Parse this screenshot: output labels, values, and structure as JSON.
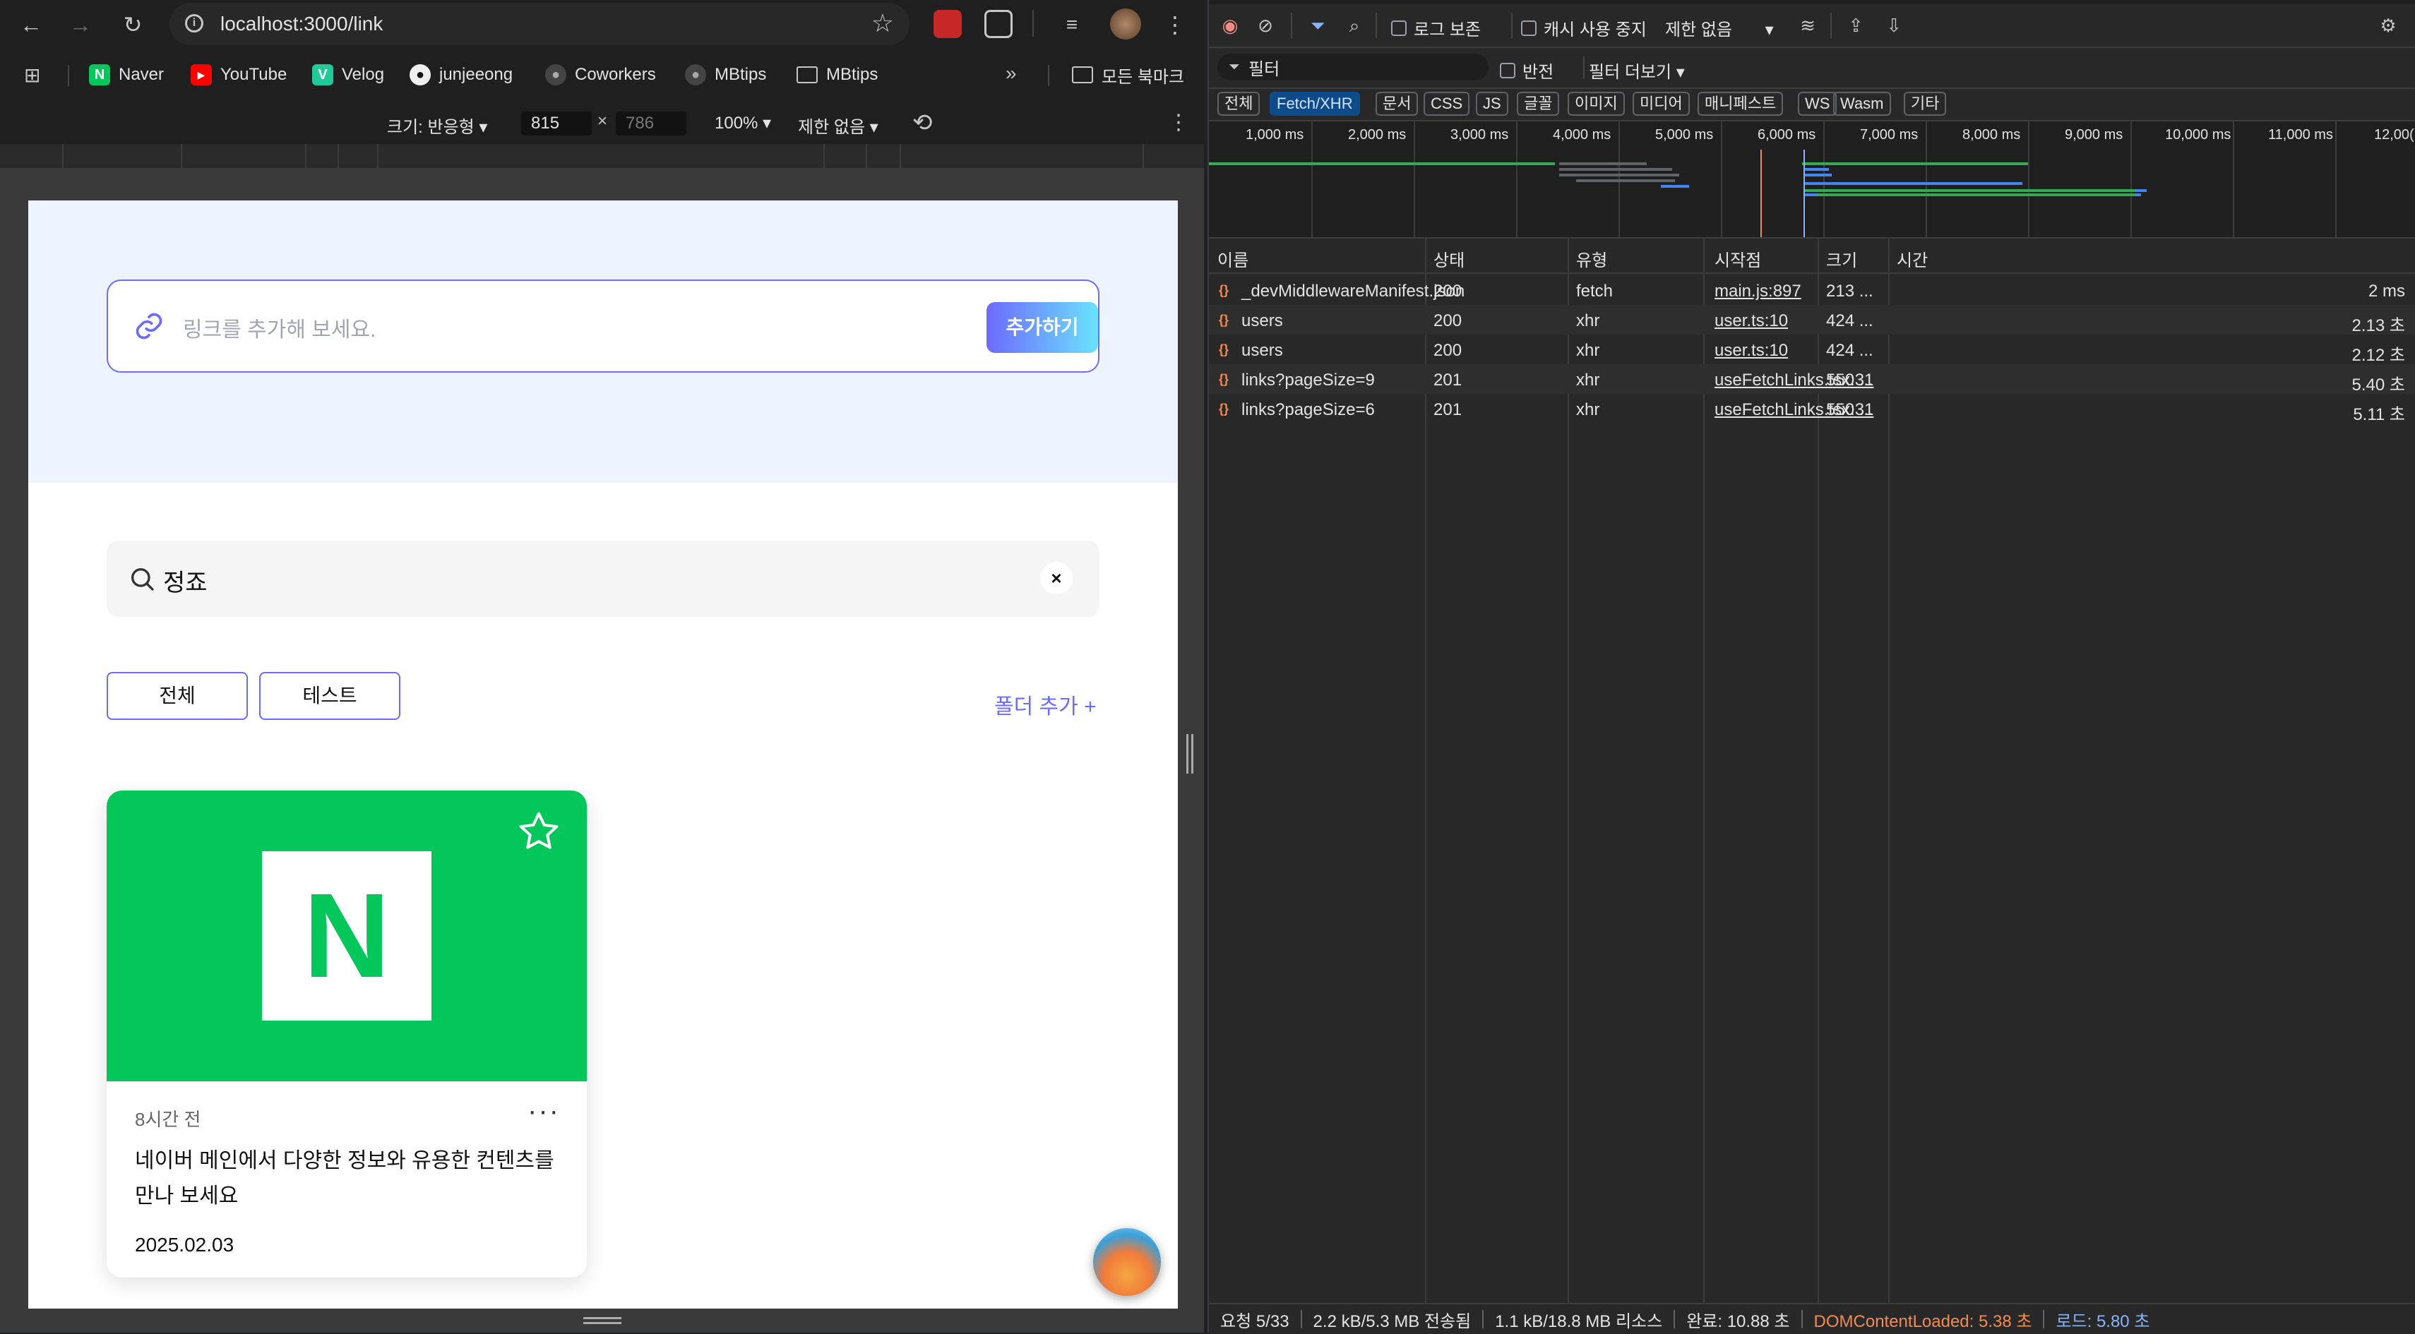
{
  "browser": {
    "url": "localhost:3000/link",
    "bookmarks": [
      {
        "label": "Naver",
        "icon": "naver-icon",
        "color": "#03c75a"
      },
      {
        "label": "YouTube",
        "icon": "youtube-icon",
        "color": "#ff0000"
      },
      {
        "label": "Velog",
        "icon": "velog-icon",
        "color": "#20c997"
      },
      {
        "label": "junjeeong",
        "icon": "github-icon"
      },
      {
        "label": "Coworkers",
        "icon": "github-icon"
      },
      {
        "label": "MBtips",
        "icon": "github-icon"
      },
      {
        "label": "MBtips",
        "icon": "folder-icon"
      }
    ],
    "all_bookmarks": "모든 북마크",
    "device": {
      "size_label": "크기: 반응형",
      "width": "815",
      "height": "786",
      "zoom": "100%",
      "throttle": "제한 없음",
      "times": "×"
    }
  },
  "page": {
    "link_placeholder": "링크를 추가해 보세요.",
    "add_button": "추가하기",
    "search_value": "정죠",
    "folders": [
      "전체",
      "테스트"
    ],
    "add_folder": "폴더 추가 +",
    "card": {
      "time": "8시간 전",
      "description": "네이버 메인에서 다양한 정보와 유용한 컨텐츠를 만나 보세요",
      "date": "2025.02.03",
      "logo_letter": "N",
      "more": "···"
    }
  },
  "devtools": {
    "toolbar": {
      "preserve_log": "로그 보존",
      "disable_cache": "캐시 사용 중지",
      "throttle": "제한 없음"
    },
    "filterbar": {
      "filter_placeholder": "필터",
      "invert": "반전",
      "more_filters": "필터 더보기"
    },
    "types": [
      "전체",
      "Fetch/XHR",
      "문서",
      "CSS",
      "JS",
      "글꼴",
      "이미지",
      "미디어",
      "매니페스트",
      "WS",
      "Wasm",
      "기타"
    ],
    "active_type": "Fetch/XHR",
    "timeline_labels": [
      "1,000 ms",
      "2,000 ms",
      "3,000 ms",
      "4,000 ms",
      "5,000 ms",
      "6,000 ms",
      "7,000 ms",
      "8,000 ms",
      "9,000 ms",
      "10,000 ms",
      "11,000 ms",
      "12,00("
    ],
    "columns": [
      "이름",
      "상태",
      "유형",
      "시작점",
      "크기",
      "시간"
    ],
    "rows": [
      {
        "name": "_devMiddlewareManifest.json",
        "status": "200",
        "type": "fetch",
        "initiator": "main.js:897",
        "size": "213 ...",
        "time": "2 ms"
      },
      {
        "name": "users",
        "status": "200",
        "type": "xhr",
        "initiator": "user.ts:10",
        "size": "424 ...",
        "time": "2.13 초"
      },
      {
        "name": "users",
        "status": "200",
        "type": "xhr",
        "initiator": "user.ts:10",
        "size": "424 ...",
        "time": "2.12 초"
      },
      {
        "name": "links?pageSize=9",
        "status": "201",
        "type": "xhr",
        "initiator": "useFetchLinks.tsx:31",
        "size": "550 ...",
        "time": "5.40 초"
      },
      {
        "name": "links?pageSize=6",
        "status": "201",
        "type": "xhr",
        "initiator": "useFetchLinks.tsx:31",
        "size": "550 ...",
        "time": "5.11 초"
      }
    ],
    "status": {
      "requests": "요청 5/33",
      "transferred": "2.2 kB/5.3 MB 전송됨",
      "resources": "1.1 kB/18.8 MB 리소스",
      "finish": "완료: 10.88 초",
      "dom_content_loaded": "DOMContentLoaded: 5.38 초",
      "load": "로드: 5.80 초"
    },
    "colors": {
      "dcl": "#f28b54",
      "load": "#8ab4f8",
      "accent": "#6d6afe"
    }
  }
}
